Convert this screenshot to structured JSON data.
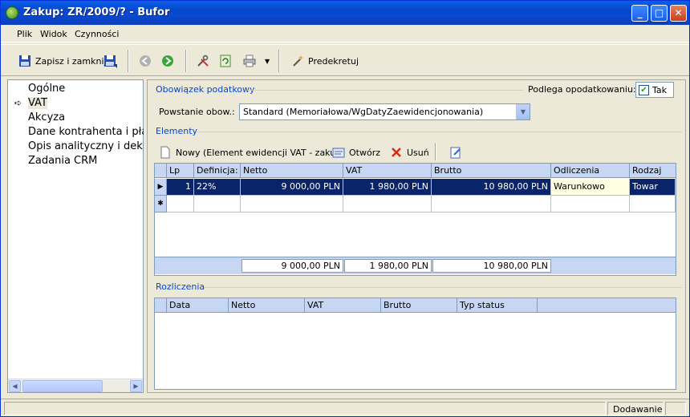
{
  "window": {
    "title": "Zakup: ZR/2009/? - Bufor",
    "min": "_",
    "max": "□",
    "close": "✕"
  },
  "menu": [
    {
      "label": "Plik"
    },
    {
      "label": "Widok"
    },
    {
      "label": "Czynności"
    }
  ],
  "toolbar": {
    "save_close": "Zapisz i zamknij",
    "predekretuj": "Predekretuj"
  },
  "nav": {
    "items": [
      {
        "label": "Ogólne"
      },
      {
        "label": "VAT"
      },
      {
        "label": "Akcyza"
      },
      {
        "label": "Dane kontrahenta i płatn"
      },
      {
        "label": "Opis analityczny i dekret"
      },
      {
        "label": "Zadania CRM"
      }
    ],
    "selected": "VAT"
  },
  "obowiazek": {
    "group_label": "Obowiązek podatkowy",
    "podlega_label": "Podlega opodatkowaniu:",
    "podlega_checked": true,
    "podlega_value": "Tak",
    "powstanie_label": "Powstanie obow.:",
    "powstanie_value": "Standard (Memoriałowa/WgDatyZaewidencjonowania)"
  },
  "elementy": {
    "group_label": "Elementy",
    "new_label": "Nowy (Element ewidencji VAT - zakup)",
    "open_label": "Otwórz",
    "delete_label": "Usuń",
    "columns": [
      "Lp",
      "Definicja:",
      "Netto",
      "VAT",
      "Brutto",
      "Odliczenia",
      "Rodzaj"
    ],
    "rows": [
      {
        "lp": "1",
        "definicja": "22%",
        "netto": "9 000,00 PLN",
        "vat": "1 980,00 PLN",
        "brutto": "10 980,00 PLN",
        "odliczenia": "Warunkowo",
        "rodzaj": "Towar"
      }
    ],
    "new_row_marker": "✱",
    "current_row_marker": "▶",
    "totals": {
      "netto": "9 000,00 PLN",
      "vat": "1 980,00 PLN",
      "brutto": "10 980,00 PLN"
    }
  },
  "rozliczenia": {
    "group_label": "Rozliczenia",
    "columns": [
      "Data",
      "Netto",
      "VAT",
      "Brutto",
      "Typ status"
    ]
  },
  "status": {
    "mode": "Dodawanie"
  }
}
